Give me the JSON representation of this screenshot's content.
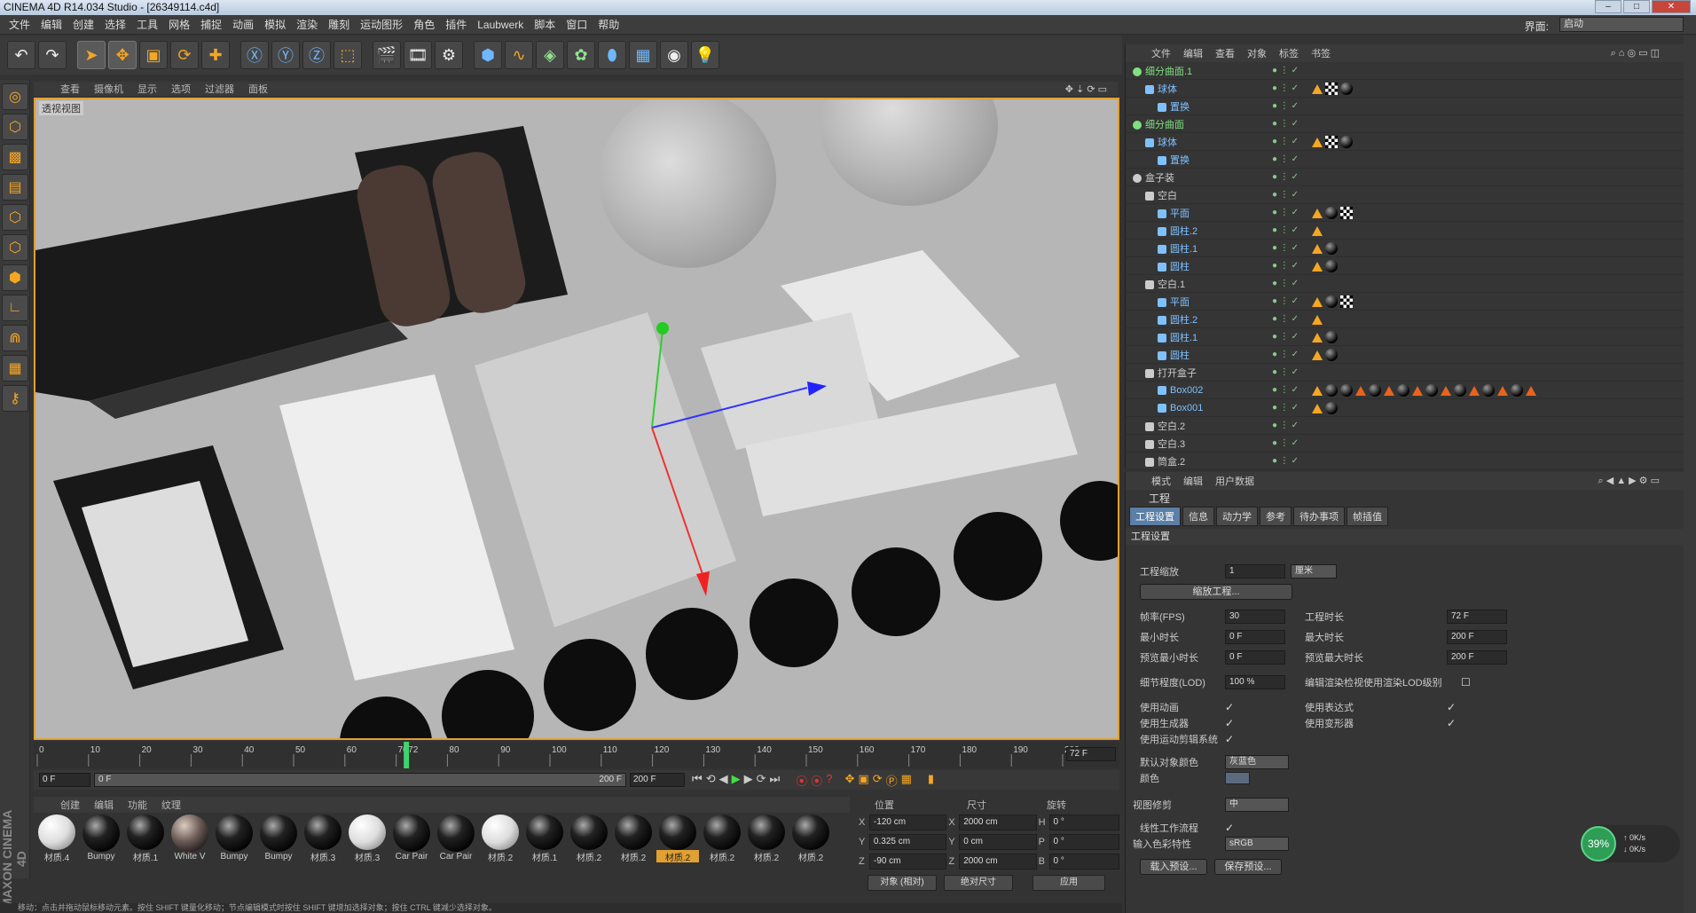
{
  "window": {
    "title": "CINEMA 4D R14.034 Studio - [26349114.c4d]"
  },
  "menubar": {
    "items": [
      "文件",
      "编辑",
      "创建",
      "选择",
      "工具",
      "网格",
      "捕捉",
      "动画",
      "模拟",
      "渲染",
      "雕刻",
      "运动图形",
      "角色",
      "插件",
      "Laubwerk",
      "脚本",
      "窗口",
      "帮助"
    ],
    "layout_label": "界面:",
    "layout_value": "启动"
  },
  "viewport": {
    "menu": [
      "查看",
      "摄像机",
      "显示",
      "选项",
      "过滤器",
      "面板"
    ],
    "name": "透视视图"
  },
  "timeline": {
    "ticks": [
      "0",
      "10",
      "20",
      "30",
      "40",
      "50",
      "60",
      "70",
      "72",
      "80",
      "90",
      "100",
      "110",
      "120",
      "130",
      "140",
      "150",
      "160",
      "170",
      "180",
      "190",
      "200"
    ],
    "current_frame": "72 F",
    "start": "0 F",
    "range_start": "0 F",
    "range_end": "200 F",
    "end": "200 F",
    "playhead": 0.36
  },
  "materials": {
    "menu": [
      "创建",
      "编辑",
      "功能",
      "纹理"
    ],
    "items": [
      {
        "label": "材质.4",
        "kind": "white"
      },
      {
        "label": "Bumpy",
        "kind": "dark"
      },
      {
        "label": "材质.1",
        "kind": "dark"
      },
      {
        "label": "White V",
        "kind": "brown"
      },
      {
        "label": "Bumpy",
        "kind": "dark"
      },
      {
        "label": "Bumpy",
        "kind": "dark"
      },
      {
        "label": "材质.3",
        "kind": "dark"
      },
      {
        "label": "材质.3",
        "kind": "white"
      },
      {
        "label": "Car Pair",
        "kind": "dark"
      },
      {
        "label": "Car Pair",
        "kind": "dark"
      },
      {
        "label": "材质.2",
        "kind": "white"
      },
      {
        "label": "材质.1",
        "kind": "dark"
      },
      {
        "label": "材质.2",
        "kind": "dark"
      },
      {
        "label": "材质.2",
        "kind": "dark"
      },
      {
        "label": "材质.2",
        "kind": "dark",
        "highlight": true
      },
      {
        "label": "材质.2",
        "kind": "dark"
      },
      {
        "label": "材质.2",
        "kind": "dark"
      },
      {
        "label": "材质.2",
        "kind": "dark"
      }
    ]
  },
  "coords": {
    "headers": [
      "位置",
      "尺寸",
      "旋转"
    ],
    "rows": [
      {
        "axis": "X",
        "pos": "-120 cm",
        "saxis": "X",
        "size": "2000 cm",
        "raxis": "H",
        "rot": "0 °"
      },
      {
        "axis": "Y",
        "pos": "0.325 cm",
        "saxis": "Y",
        "size": "0 cm",
        "raxis": "P",
        "rot": "0 °"
      },
      {
        "axis": "Z",
        "pos": "-90 cm",
        "saxis": "Z",
        "size": "2000 cm",
        "raxis": "B",
        "rot": "0 °"
      }
    ],
    "mode1": "对象 (相对)",
    "mode2": "绝对尺寸",
    "apply": "应用"
  },
  "object_manager": {
    "menu": [
      "文件",
      "编辑",
      "查看",
      "对象",
      "标签",
      "书签"
    ],
    "rows": [
      {
        "name": "细分曲面.1",
        "indent": 0,
        "color": "#7fe07f",
        "tags": []
      },
      {
        "name": "球体",
        "indent": 1,
        "color": "#7fc1ff",
        "tags": [
          "t",
          "c",
          "m"
        ]
      },
      {
        "name": "置换",
        "indent": 2,
        "color": "#7fc1ff",
        "tags": []
      },
      {
        "name": "细分曲面",
        "indent": 0,
        "color": "#7fe07f",
        "tags": []
      },
      {
        "name": "球体",
        "indent": 1,
        "color": "#7fc1ff",
        "tags": [
          "t",
          "c",
          "m"
        ]
      },
      {
        "name": "置换",
        "indent": 2,
        "color": "#7fc1ff",
        "tags": []
      },
      {
        "name": "盒子装",
        "indent": 0,
        "color": "#cccccc",
        "tags": []
      },
      {
        "name": "空白",
        "indent": 1,
        "color": "#cccccc",
        "tags": []
      },
      {
        "name": "平面",
        "indent": 2,
        "color": "#7fc1ff",
        "tags": [
          "t",
          "m",
          "c"
        ]
      },
      {
        "name": "圆柱.2",
        "indent": 2,
        "color": "#7fc1ff",
        "tags": [
          "t"
        ]
      },
      {
        "name": "圆柱.1",
        "indent": 2,
        "color": "#7fc1ff",
        "tags": [
          "t",
          "b"
        ]
      },
      {
        "name": "圆柱",
        "indent": 2,
        "color": "#7fc1ff",
        "tags": [
          "t",
          "b"
        ]
      },
      {
        "name": "空白.1",
        "indent": 1,
        "color": "#cccccc",
        "tags": []
      },
      {
        "name": "平面",
        "indent": 2,
        "color": "#7fc1ff",
        "tags": [
          "t",
          "m",
          "c"
        ]
      },
      {
        "name": "圆柱.2",
        "indent": 2,
        "color": "#7fc1ff",
        "tags": [
          "t"
        ]
      },
      {
        "name": "圆柱.1",
        "indent": 2,
        "color": "#7fc1ff",
        "tags": [
          "t",
          "b"
        ]
      },
      {
        "name": "圆柱",
        "indent": 2,
        "color": "#7fc1ff",
        "tags": [
          "t",
          "b"
        ]
      },
      {
        "name": "打开盒子",
        "indent": 1,
        "color": "#cccccc",
        "tags": []
      },
      {
        "name": "Box002",
        "indent": 2,
        "color": "#7fc1ff",
        "tags": [
          "t",
          "b",
          "b",
          "x",
          "b",
          "x",
          "b",
          "x",
          "b",
          "x",
          "b",
          "x",
          "b",
          "x",
          "b",
          "x"
        ]
      },
      {
        "name": "Box001",
        "indent": 2,
        "color": "#7fc1ff",
        "tags": [
          "t",
          "b"
        ]
      },
      {
        "name": "空白.2",
        "indent": 1,
        "color": "#cccccc",
        "tags": []
      },
      {
        "name": "空白.3",
        "indent": 1,
        "color": "#cccccc",
        "tags": []
      },
      {
        "name": "筒盒.2",
        "indent": 1,
        "color": "#cccccc",
        "tags": []
      }
    ]
  },
  "attribute_manager": {
    "menu": [
      "模式",
      "编辑",
      "用户数据"
    ],
    "title": "工程",
    "tabs": [
      "工程设置",
      "信息",
      "动力学",
      "参考",
      "待办事项",
      "帧插值"
    ],
    "section": "工程设置",
    "project_scale_label": "工程缩放",
    "project_scale_value": "1",
    "project_scale_unit": "厘米",
    "scale_button": "缩放工程...",
    "fps_label": "帧率(FPS)",
    "fps_value": "30",
    "project_time_label": "工程时长",
    "project_time_value": "72 F",
    "min_time_label": "最小时长",
    "min_time_value": "0 F",
    "max_time_label": "最大时长",
    "max_time_value": "200 F",
    "preview_min_label": "预览最小时长",
    "preview_min_value": "0 F",
    "preview_max_label": "预览最大时长",
    "preview_max_value": "200 F",
    "lod_label": "细节程度(LOD)",
    "lod_value": "100 %",
    "lod_render_label": "编辑渲染检视使用渲染LOD级别",
    "use_anim_label": "使用动画",
    "use_expr_label": "使用表达式",
    "use_gen_label": "使用生成器",
    "use_deform_label": "使用变形器",
    "use_motion_label": "使用运动剪辑系统",
    "default_color_label": "默认对象颜色",
    "default_color_value": "灰蓝色",
    "color_label": "颜色",
    "view_clip_label": "视图修剪",
    "view_clip_value": "中",
    "linear_label": "线性工作流程",
    "input_color_label": "输入色彩特性",
    "input_color_value": "sRGB",
    "load_preset": "载入预设...",
    "save_preset": "保存预设..."
  },
  "net": {
    "percent": "39%",
    "up": "0K/s",
    "down": "0K/s"
  },
  "statusbar": {
    "text": "移动：点击并拖动鼠标移动元素。按住 SHIFT 键量化移动；节点编辑模式时按住 SHIFT 键增加选择对象；按住 CTRL 键减少选择对象。"
  },
  "brand": "MAXON CINEMA 4D"
}
